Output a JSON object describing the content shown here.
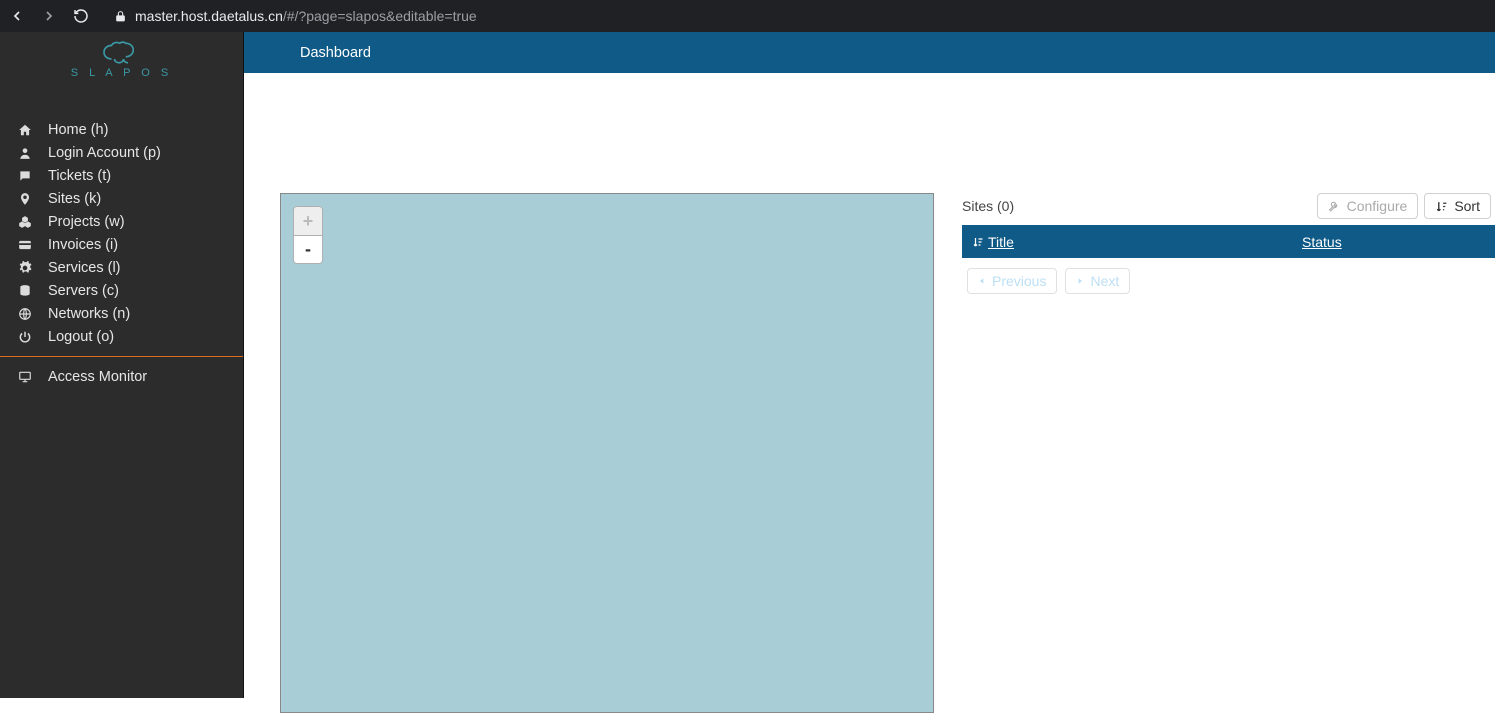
{
  "browser": {
    "url_host": "master.host.daetalus.cn",
    "url_path": "/#/?page=slapos&editable=true"
  },
  "logo": {
    "text": "S L A P O S"
  },
  "sidebar": {
    "items": [
      {
        "label": "Home (h)",
        "icon": "home-icon"
      },
      {
        "label": "Login Account (p)",
        "icon": "user-icon"
      },
      {
        "label": "Tickets (t)",
        "icon": "chat-icon"
      },
      {
        "label": "Sites (k)",
        "icon": "pin-icon"
      },
      {
        "label": "Projects (w)",
        "icon": "cubes-icon"
      },
      {
        "label": "Invoices (i)",
        "icon": "card-icon"
      },
      {
        "label": "Services (l)",
        "icon": "gear-icon"
      },
      {
        "label": "Servers (c)",
        "icon": "database-icon"
      },
      {
        "label": "Networks (n)",
        "icon": "globe-icon"
      },
      {
        "label": "Logout (o)",
        "icon": "power-icon"
      }
    ],
    "secondary": [
      {
        "label": "Access Monitor",
        "icon": "monitor-icon"
      }
    ]
  },
  "header": {
    "title": "Dashboard"
  },
  "map": {
    "zoom_in": "+",
    "zoom_out": "-"
  },
  "sites_panel": {
    "title": "Sites (0)",
    "configure_label": "Configure",
    "sort_label": "Sort",
    "col_title": "Title",
    "col_status": "Status",
    "prev_label": "Previous",
    "next_label": "Next"
  }
}
